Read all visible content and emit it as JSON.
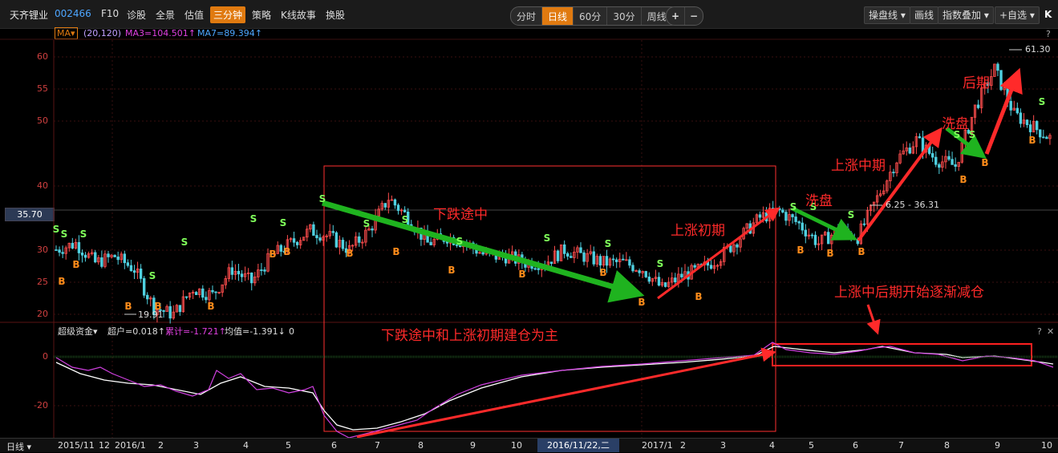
{
  "toolbar": {
    "stock_name": "天齐锂业",
    "stock_code": "002466",
    "links": [
      "F10",
      "诊股",
      "全景",
      "估值",
      "三分钟",
      "策略",
      "K线故事",
      "换股"
    ],
    "active_link": "三分钟",
    "periods": [
      "分时",
      "日线",
      "60分",
      "30分",
      "周线 ▾"
    ],
    "active_period": "日线",
    "zoom_in": "+",
    "zoom_out": "−",
    "right_buttons": [
      "操盘线 ▾",
      "画线",
      "指数叠加 ▾",
      "+自选 ▾"
    ],
    "k_logo": "K"
  },
  "ma_line": {
    "badge": "MA▾",
    "params": "(20,120)",
    "ma3": "MA3=104.501↑",
    "ma7": "MA7=89.394↑",
    "help": "?"
  },
  "price_axis": {
    "ticks": [
      "60",
      "55",
      "50",
      "40",
      "30",
      "25",
      "20"
    ],
    "current_tag": "35.70",
    "high_label": "61.30",
    "low_label": "19.91",
    "range_label": "6.25 - 36.31"
  },
  "indicator": {
    "name": "超级资金▾",
    "super": "超户=0.018↑",
    "cumulative": "累计=-1.721↑",
    "avg": "均值=-1.391↓",
    "zero": "0",
    "help": "?",
    "close": "✕",
    "ticks": [
      "0",
      "-20"
    ]
  },
  "x_axis": {
    "period_label": "日线 ▾",
    "labels": [
      "2015/11",
      "12",
      "2016/1",
      "2",
      "3",
      "4",
      "5",
      "6",
      "7",
      "8",
      "9",
      "10",
      "2016/11/22,二",
      "2017/1",
      "2",
      "3",
      "4",
      "5",
      "6",
      "7",
      "8",
      "9",
      "10"
    ]
  },
  "annotations": {
    "falling_mid": "下跌途中",
    "rise_early": "上涨初期",
    "washout1": "洗盘",
    "rise_mid": "上涨中期",
    "washout2": "洗盘",
    "late": "后期",
    "reduce": "上涨中后期开始逐渐减仓",
    "build": "下跌途中和上涨初期建仓为主"
  },
  "signals": {
    "buy": "B",
    "sell": "S"
  },
  "chart_data": {
    "type": "line",
    "title": "",
    "ylabel": "",
    "ylim": [
      19,
      62
    ],
    "series": [
      {
        "values": [
          30,
          31,
          28,
          29,
          27,
          21,
          20,
          24,
          23,
          27,
          25,
          29,
          31,
          33,
          32,
          30,
          33,
          38,
          35,
          31,
          32,
          31,
          29,
          29,
          28,
          28,
          30,
          29,
          28,
          28,
          27,
          24,
          26,
          27,
          29,
          32,
          35,
          36,
          34,
          31,
          33,
          32,
          38,
          44,
          47,
          44,
          43,
          52,
          58,
          51,
          49,
          47
        ]
      }
    ],
    "indicator_ylim": [
      -30,
      4
    ]
  },
  "colors": {
    "rise": "#ff4d4d",
    "fall": "#4fd0e0",
    "ma_magenta": "#e040e0",
    "ma_white": "#ffffff",
    "green_arrow": "#1fb31f",
    "red_arrow": "#ff2a2a",
    "accent": "#e07a10"
  }
}
